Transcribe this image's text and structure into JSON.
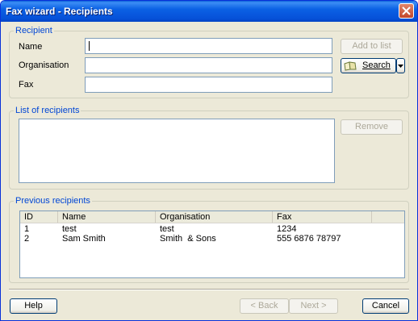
{
  "window": {
    "title": "Fax wizard - Recipients"
  },
  "recipient": {
    "legend": "Recipient",
    "name_label": "Name",
    "organisation_label": "Organisation",
    "fax_label": "Fax",
    "name_value": "",
    "organisation_value": "",
    "fax_value": "",
    "add_button": "Add to list",
    "search_button": "Search"
  },
  "list_of_recipients": {
    "legend": "List of recipients",
    "remove_button": "Remove"
  },
  "previous_recipients": {
    "legend": "Previous recipients",
    "columns": [
      "ID",
      "Name",
      "Organisation",
      "Fax"
    ],
    "rows": [
      [
        "1",
        "test",
        "test",
        "1234"
      ],
      [
        "2",
        "Sam Smith",
        "Smith  & Sons",
        "555 6876 78797"
      ]
    ]
  },
  "footer": {
    "help": "Help",
    "back": "< Back",
    "next": "Next >",
    "cancel": "Cancel"
  }
}
